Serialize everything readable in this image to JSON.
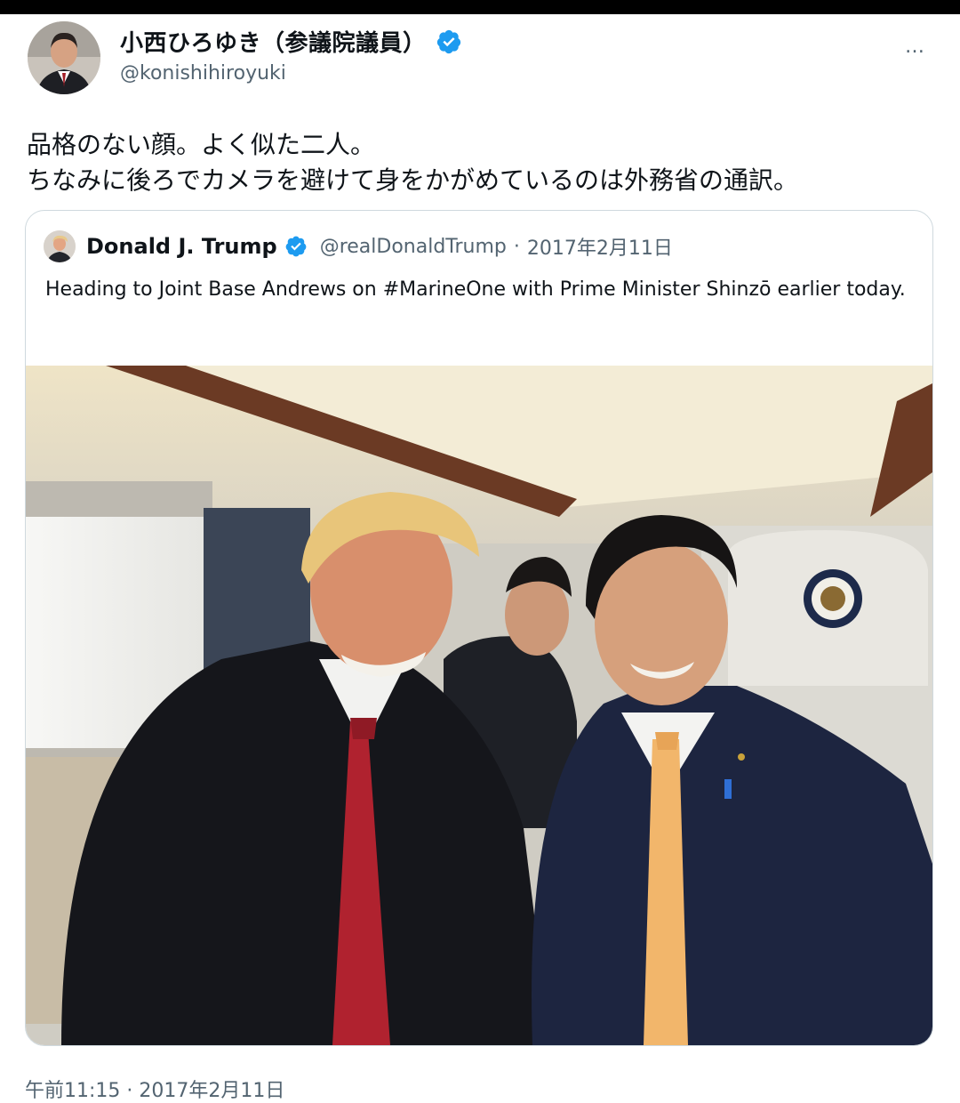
{
  "author": {
    "name": "小西ひろゆき（参議院議員）",
    "handle": "@konishihiroyuki",
    "verified_icon": "verified-badge",
    "more_icon": "more-dots-icon",
    "more_label": "…"
  },
  "tweet": {
    "lines": [
      "品格のない顔。よく似た二人。",
      "ちなみに後ろでカメラを避けて身をかがめているのは外務省の通訳。"
    ]
  },
  "quoted_tweet": {
    "name": "Donald J. Trump",
    "handle": "@realDonaldTrump",
    "separator": "·",
    "date": "2017年2月11日",
    "text": "Heading to Joint Base Andrews on #MarineOne with Prime Minister Shinzō earlier today."
  },
  "footer": {
    "timestamp": "午前11:15 · 2017年2月11日"
  },
  "colors": {
    "verified_blue": "#1d9bf0",
    "secondary_text": "#536471",
    "border": "#cfd9de"
  }
}
